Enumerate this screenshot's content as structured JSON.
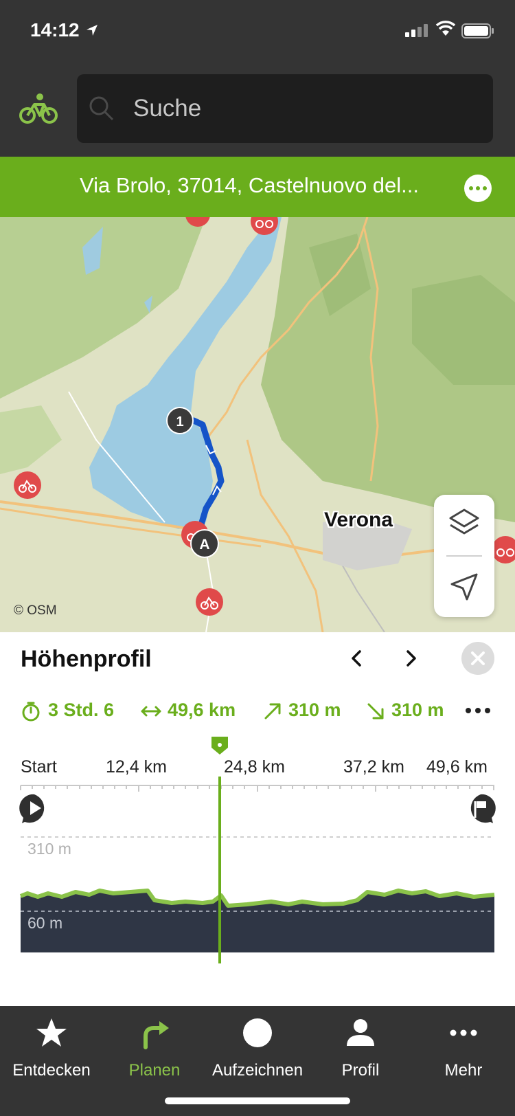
{
  "status_bar": {
    "time": "14:12"
  },
  "search": {
    "placeholder": "Suche"
  },
  "address": {
    "text": "Via Brolo, 37014, Castelnuovo del..."
  },
  "map": {
    "city": "Verona",
    "attribution": "© OSM",
    "waypoints": [
      "1",
      "A"
    ]
  },
  "panel": {
    "title": "Höhenprofil",
    "stats": {
      "duration": "3 Std. 6",
      "distance": "49,6 km",
      "ascent": "310 m",
      "descent": "310 m"
    },
    "axis_ticks": [
      "Start",
      "12,4 km",
      "24,8 km",
      "37,2 km",
      "49,6 km"
    ],
    "elevation_max_label": "310 m",
    "elevation_min_label": "60 m",
    "cursor_fraction": 0.42
  },
  "tabs": [
    {
      "label": "Entdecken",
      "icon": "star-icon",
      "active": false
    },
    {
      "label": "Planen",
      "icon": "route-arrow-icon",
      "active": true
    },
    {
      "label": "Aufzeichnen",
      "icon": "record-icon",
      "active": false
    },
    {
      "label": "Profil",
      "icon": "person-icon",
      "active": false
    },
    {
      "label": "Mehr",
      "icon": "more-icon",
      "active": false
    }
  ],
  "colors": {
    "accent_green": "#6aae1c",
    "header_dark": "#343434",
    "route_blue": "#1554c8",
    "profile_fill": "#2f3645"
  }
}
